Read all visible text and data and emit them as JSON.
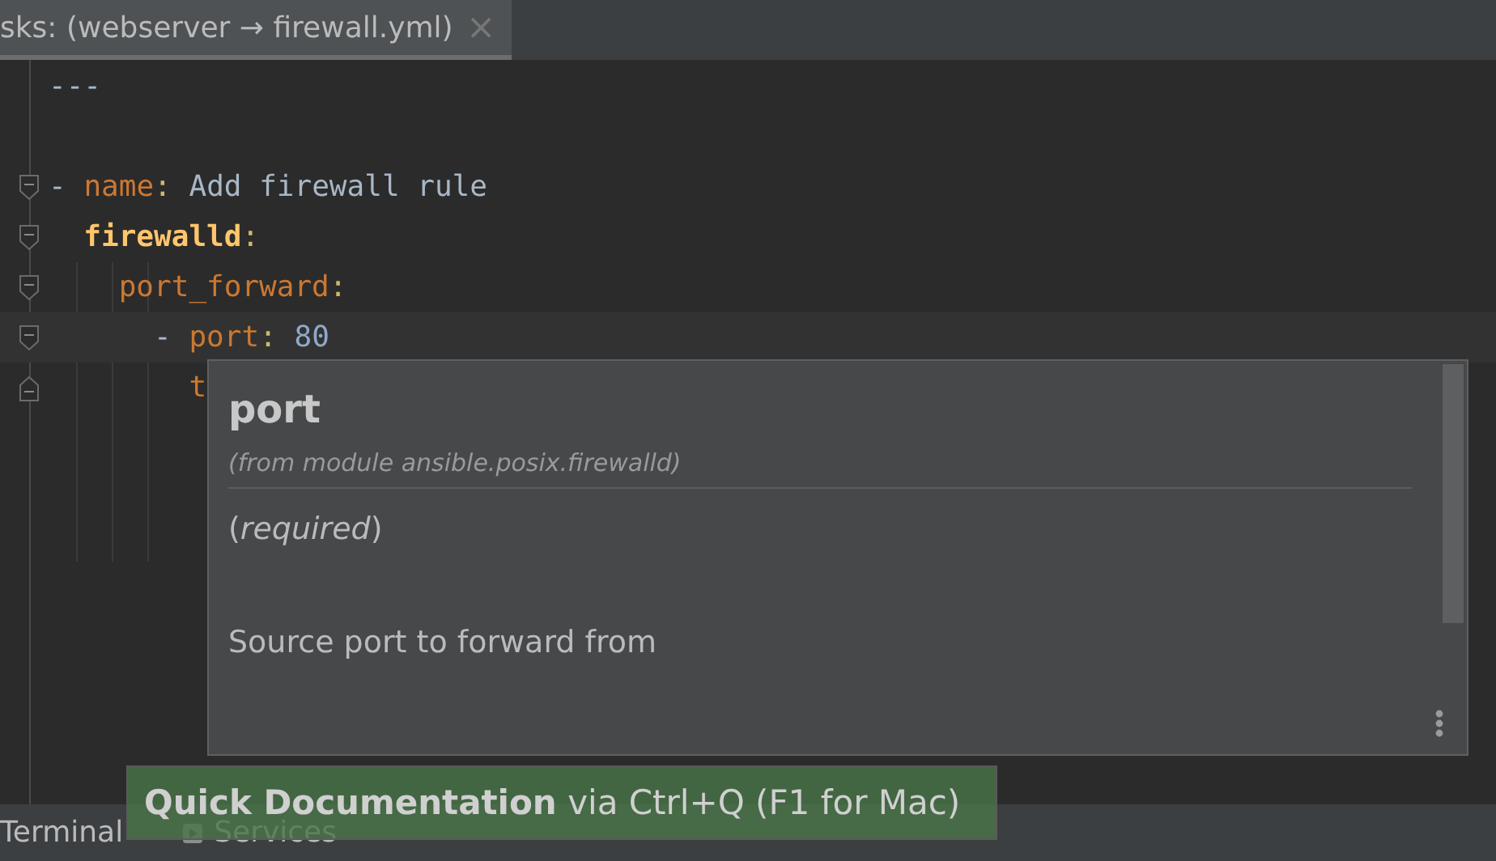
{
  "tab": {
    "title": "sks: (webserver → firewall.yml)",
    "close": "×",
    "selected": true
  },
  "editor": {
    "lines": [
      {
        "current": false,
        "tokens": [
          {
            "kind": "plain",
            "text": "---"
          }
        ]
      },
      {
        "current": false,
        "tokens": [
          {
            "kind": "plain",
            "text": "-"
          },
          {
            "kind": "key",
            "text": "name"
          },
          {
            "kind": "colon",
            "text": ":"
          },
          {
            "kind": "plain",
            "text": "Add firewall rule"
          }
        ],
        "children": [
          {
            "current": false,
            "tokens": [
              {
                "kind": "module",
                "text": "firewalld"
              },
              {
                "kind": "colon",
                "text": ":"
              }
            ],
            "children": [
              {
                "current": false,
                "tokens": [
                  {
                    "kind": "key",
                    "text": "port_forward"
                  },
                  {
                    "kind": "colon",
                    "text": ":"
                  }
                ],
                "children": [
                  {
                    "current": true,
                    "tokens": [
                      {
                        "kind": "plain",
                        "text": "-"
                      },
                      {
                        "kind": "key",
                        "text": "port"
                      },
                      {
                        "kind": "colon",
                        "text": ":"
                      },
                      {
                        "kind": "number",
                        "text": "80"
                      }
                    ],
                    "children": [
                      {
                        "current": false,
                        "fold_end": true,
                        "tokens": [
                          {
                            "kind": "key",
                            "text": "t"
                          }
                        ]
                      }
                    ]
                  }
                ]
              }
            ]
          }
        ]
      }
    ]
  },
  "doc_popup": {
    "title": "port",
    "subtitle": "(from module ansible.posix.firewalld)",
    "paragraphs": [
      "(*required*)",
      "Source port to forward from"
    ]
  },
  "hint": {
    "text": "**Quick Documentation** via Ctrl+Q (F1 for Mac)"
  },
  "bottom_tabs": [
    {
      "label": "Terminal",
      "icon": false
    },
    {
      "label": "Services",
      "icon": true
    }
  ]
}
